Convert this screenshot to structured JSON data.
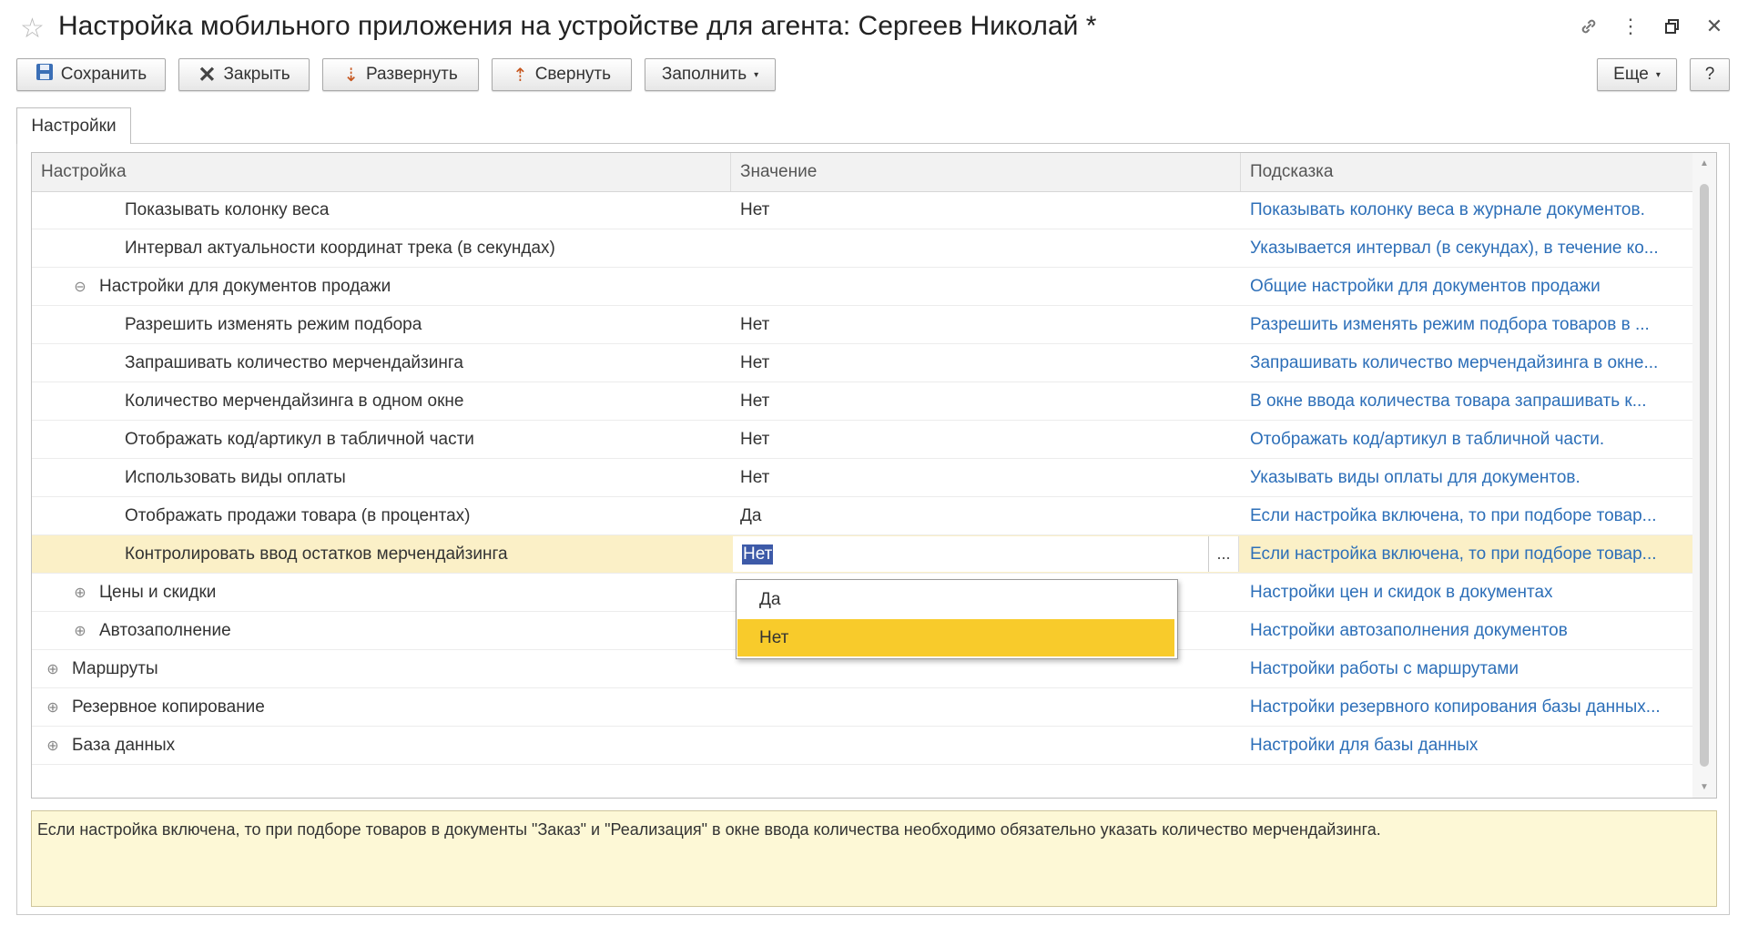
{
  "window": {
    "title": "Настройка мобильного приложения на устройстве для агента: Сергеев Николай *"
  },
  "toolbar": {
    "save": "Сохранить",
    "close": "Закрыть",
    "expand": "Развернуть",
    "collapse": "Свернуть",
    "fill": "Заполнить",
    "more": "Еще",
    "help": "?"
  },
  "tabs": {
    "settings": "Настройки"
  },
  "grid": {
    "headers": [
      "Настройка",
      "Значение",
      "Подсказка"
    ],
    "rows": [
      {
        "label": "Показывать колонку веса",
        "value": "Нет",
        "hint": "Показывать колонку веса в журнале документов."
      },
      {
        "label": "Интервал актуальности координат трека (в секундах)",
        "value": "",
        "hint": "Указывается интервал (в секундах), в течение ко..."
      },
      {
        "label": "Настройки для документов продажи",
        "value": "",
        "hint": "Общие настройки для документов продажи",
        "expander": "⊖"
      },
      {
        "label": "Разрешить изменять режим подбора",
        "value": "Нет",
        "hint": "Разрешить изменять режим подбора товаров в ..."
      },
      {
        "label": "Запрашивать количество мерчендайзинга",
        "value": "Нет",
        "hint": "Запрашивать количество мерчендайзинга в окне..."
      },
      {
        "label": "Количество мерчендайзинга в одном окне",
        "value": "Нет",
        "hint": "В окне ввода количества товара запрашивать к..."
      },
      {
        "label": "Отображать код/артикул в табличной части",
        "value": "Нет",
        "hint": "Отображать код/артикул в табличной части."
      },
      {
        "label": "Использовать виды оплаты",
        "value": "Нет",
        "hint": "Указывать виды оплаты для документов."
      },
      {
        "label": "Отображать продажи товара (в процентах)",
        "value": "Да",
        "hint": "Если настройка включена, то при подборе товар..."
      },
      {
        "label": "Контролировать ввод остатков мерчендайзинга",
        "value": "Нет",
        "hint": "Если настройка включена, то при подборе товар...",
        "selected": true
      },
      {
        "label": "Цены и скидки",
        "value": "",
        "hint": "Настройки цен и скидок в документах",
        "expander": "⊕"
      },
      {
        "label": "Автозаполнение",
        "value": "",
        "hint": "Настройки автозаполнения документов",
        "expander": "⊕"
      },
      {
        "label": "Маршруты",
        "value": "",
        "hint": "Настройки работы с маршрутами",
        "expander": "⊕"
      },
      {
        "label": "Резервное копирование",
        "value": "",
        "hint": "Настройки резервного копирования базы данных...",
        "expander": "⊕"
      },
      {
        "label": "База данных",
        "value": "",
        "hint": "Настройки для базы данных",
        "expander": "⊕"
      }
    ],
    "edit_dots": "..."
  },
  "dropdown": {
    "options": [
      "Да",
      "Нет"
    ],
    "active": "Нет"
  },
  "hint_text": "Если настройка включена, то при подборе товаров в документы \"Заказ\" и \"Реализация\" в окне ввода количества необходимо обязательно указать количество мерчендайзинга.",
  "colors": {
    "hint_link": "#2d6fb8",
    "selected_row": "#fbf0c7",
    "dropdown_active": "#f8cb2b",
    "hint_panel": "#fdf8d6"
  }
}
